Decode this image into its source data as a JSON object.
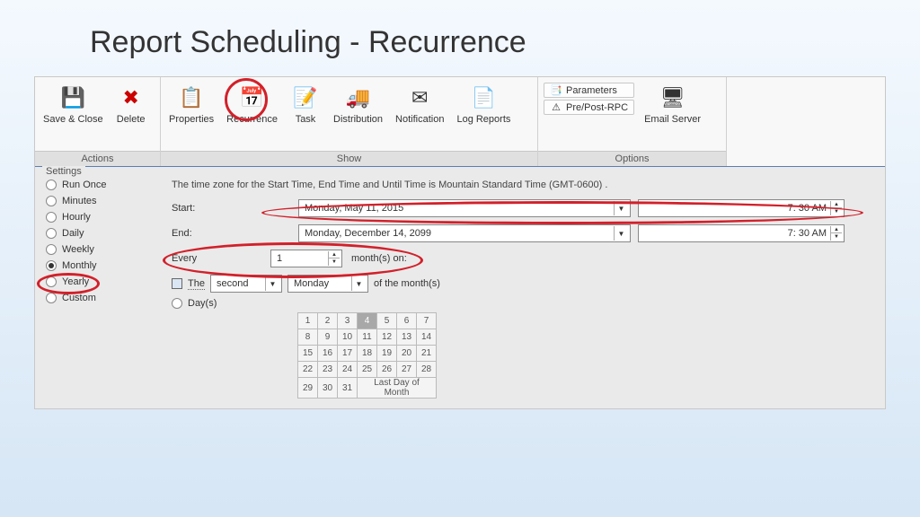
{
  "slide_title": "Report Scheduling - Recurrence",
  "ribbon": {
    "groups": [
      {
        "label": "Actions",
        "buttons": [
          {
            "label": "Save & Close",
            "icon": "💾"
          },
          {
            "label": "Delete",
            "icon": "✖"
          }
        ]
      },
      {
        "label": "Show",
        "buttons": [
          {
            "label": "Properties",
            "icon": "📋"
          },
          {
            "label": "Recurrence",
            "icon": "📅"
          },
          {
            "label": "Task",
            "icon": "📝"
          },
          {
            "label": "Distribution",
            "icon": "🚚"
          },
          {
            "label": "Notification",
            "icon": "✉"
          },
          {
            "label": "Log Reports",
            "icon": "📄"
          }
        ]
      },
      {
        "label": "Options",
        "side_buttons": [
          {
            "label": "Parameters",
            "icon": "📑"
          },
          {
            "label": "Pre/Post-RPC",
            "icon": "⚠"
          }
        ],
        "buttons": [
          {
            "label": "Email Server",
            "icon": "🖥"
          }
        ]
      }
    ]
  },
  "settings_label": "Settings",
  "recurrence_options": [
    "Run Once",
    "Minutes",
    "Hourly",
    "Daily",
    "Weekly",
    "Monthly",
    "Yearly",
    "Custom"
  ],
  "selected_recurrence": "Monthly",
  "tz_note": "The time zone for the Start Time, End Time and Until Time is Mountain Standard Time (GMT-0600) .",
  "start": {
    "label": "Start:",
    "date": "Monday, May 11, 2015",
    "time": "7:  30 AM"
  },
  "end": {
    "label": "End:",
    "date": "Monday, December 14, 2099",
    "time": "7:  30 AM"
  },
  "monthly": {
    "every_label": "Every",
    "every_value": "1",
    "months_on_label": "month(s) on:",
    "the_label": "The",
    "ordinal": "second",
    "weekday": "Monday",
    "of_label": "of the month(s)",
    "days_label": "Day(s)",
    "days_grid": [
      [
        "1",
        "2",
        "3",
        "4",
        "5",
        "6",
        "7"
      ],
      [
        "8",
        "9",
        "10",
        "11",
        "12",
        "13",
        "14"
      ],
      [
        "15",
        "16",
        "17",
        "18",
        "19",
        "20",
        "21"
      ],
      [
        "22",
        "23",
        "24",
        "25",
        "26",
        "27",
        "28"
      ],
      [
        "29",
        "30",
        "31"
      ]
    ],
    "last_day_label": "Last Day of Month",
    "selected_day": "4"
  }
}
